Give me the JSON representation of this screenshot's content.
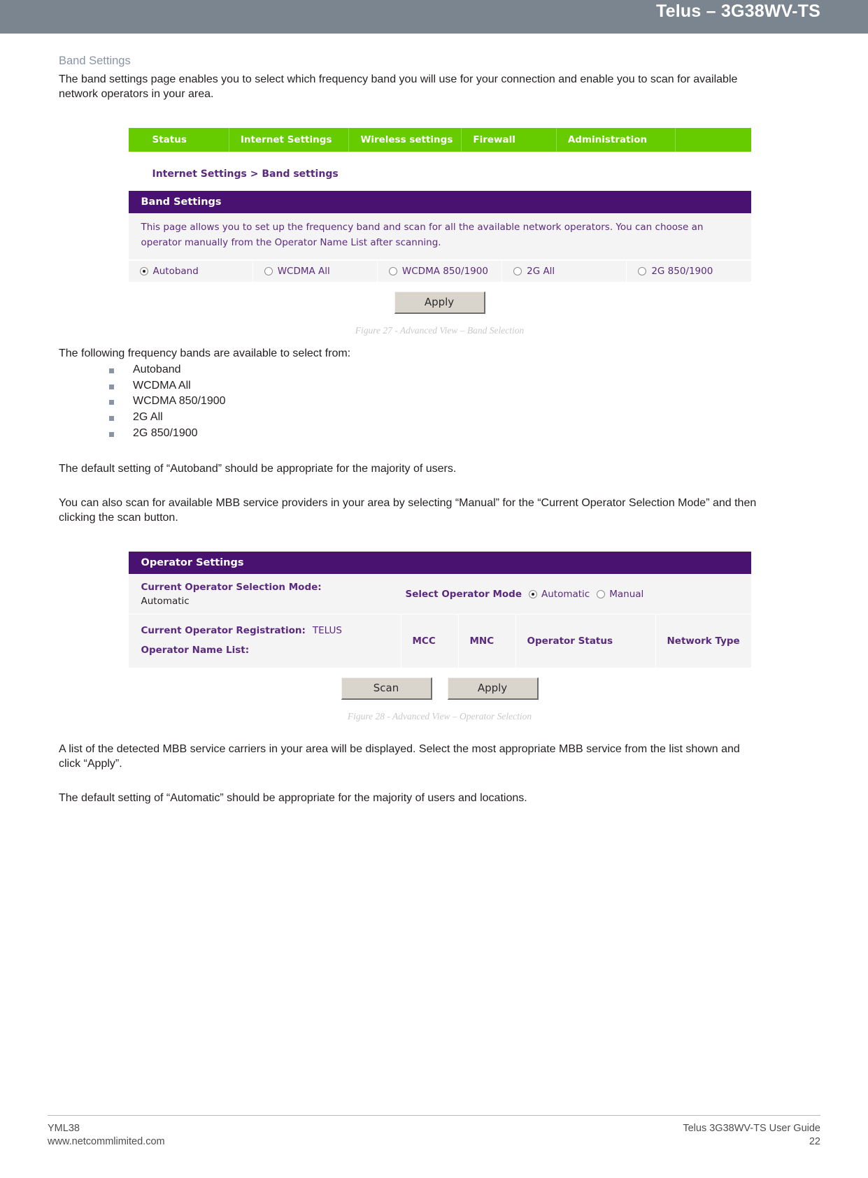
{
  "header": {
    "title": "Telus – 3G38WV-TS"
  },
  "section": {
    "heading": "Band Settings",
    "intro": "The band settings page enables you to select which frequency band you will use for your connection and enable you to scan for available network operators in your area."
  },
  "figure1": {
    "nav_tabs": [
      "Status",
      "Internet Settings",
      "Wireless settings",
      "Firewall",
      "Administration"
    ],
    "breadcrumb": "Internet Settings > Band settings",
    "panel_title": "Band Settings",
    "panel_desc": "This page allows you to set up the frequency band and scan for all the available network operators. You can choose an operator manually from the Operator Name List after scanning.",
    "band_options": [
      {
        "label": "Autoband",
        "selected": true
      },
      {
        "label": "WCDMA All",
        "selected": false
      },
      {
        "label": "WCDMA 850/1900",
        "selected": false
      },
      {
        "label": "2G All",
        "selected": false
      },
      {
        "label": "2G 850/1900",
        "selected": false
      }
    ],
    "apply_label": "Apply",
    "caption": "Figure 27 - Advanced View – Band Selection"
  },
  "list_intro": "The following frequency bands are available to select from:",
  "band_list": [
    "Autoband",
    "WCDMA All",
    "WCDMA 850/1900",
    "2G All",
    "2G 850/1900"
  ],
  "para_default_band": "The default setting of “Autoband” should be appropriate for the majority of users.",
  "para_scan": "You can also scan for available MBB service providers in your area by selecting “Manual” for the “Current Operator Selection Mode” and then clicking the scan button.",
  "figure2": {
    "panel_title": "Operator Settings",
    "current_mode_label": "Current Operator Selection Mode:",
    "current_mode_value": "Automatic",
    "select_mode_label": "Select Operator Mode",
    "mode_options": [
      {
        "label": "Automatic",
        "selected": true
      },
      {
        "label": "Manual",
        "selected": false
      }
    ],
    "registration_label": "Current Operator Registration:",
    "registration_value": "TELUS",
    "operator_name_list_label": "Operator Name List:",
    "columns": [
      "MCC",
      "MNC",
      "Operator Status",
      "Network Type"
    ],
    "scan_label": "Scan",
    "apply_label": "Apply",
    "caption": "Figure 28 - Advanced View – Operator Selection"
  },
  "para_list_detected": "A list of the detected MBB service carriers in your area will be displayed. Select the most appropriate MBB service from the list shown and click “Apply”.",
  "para_default_auto": "The default setting of “Automatic” should be appropriate for the majority of users and locations.",
  "footer": {
    "left_line1": "YML38",
    "left_line2": "www.netcommlimited.com",
    "right_line1": "Telus 3G38WV-TS User Guide",
    "right_line2": "22"
  }
}
